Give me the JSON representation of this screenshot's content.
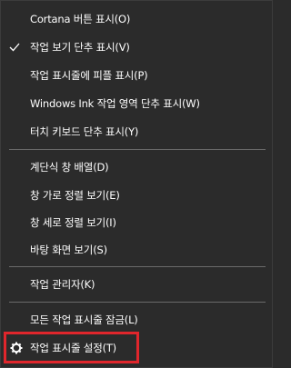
{
  "menu": {
    "items": [
      {
        "label": "Cortana 버튼 표시(O)",
        "checked": false
      },
      {
        "label": "작업 보기 단추 표시(V)",
        "checked": true
      },
      {
        "label": "작업 표시줄에 피플 표시(P)",
        "checked": false
      },
      {
        "label": "Windows Ink 작업 영역 단추 표시(W)",
        "checked": false
      },
      {
        "label": "터치 키보드 단추 표시(Y)",
        "checked": false
      },
      {
        "label": "계단식 창 배열(D)",
        "checked": false
      },
      {
        "label": "창 가로 정렬 보기(E)",
        "checked": false
      },
      {
        "label": "창 세로 정렬 보기(I)",
        "checked": false
      },
      {
        "label": "바탕 화면 보기(S)",
        "checked": false
      },
      {
        "label": "작업 관리자(K)",
        "checked": false
      },
      {
        "label": "모든 작업 표시줄 잠금(L)",
        "checked": false
      },
      {
        "label": "작업 표시줄 설정(T)",
        "icon": "gear-icon",
        "highlighted": true
      }
    ]
  },
  "colors": {
    "background": "#2b2b2b",
    "text": "#ffffff",
    "separator": "#6a6a6a",
    "highlight_border": "#e0262c"
  }
}
